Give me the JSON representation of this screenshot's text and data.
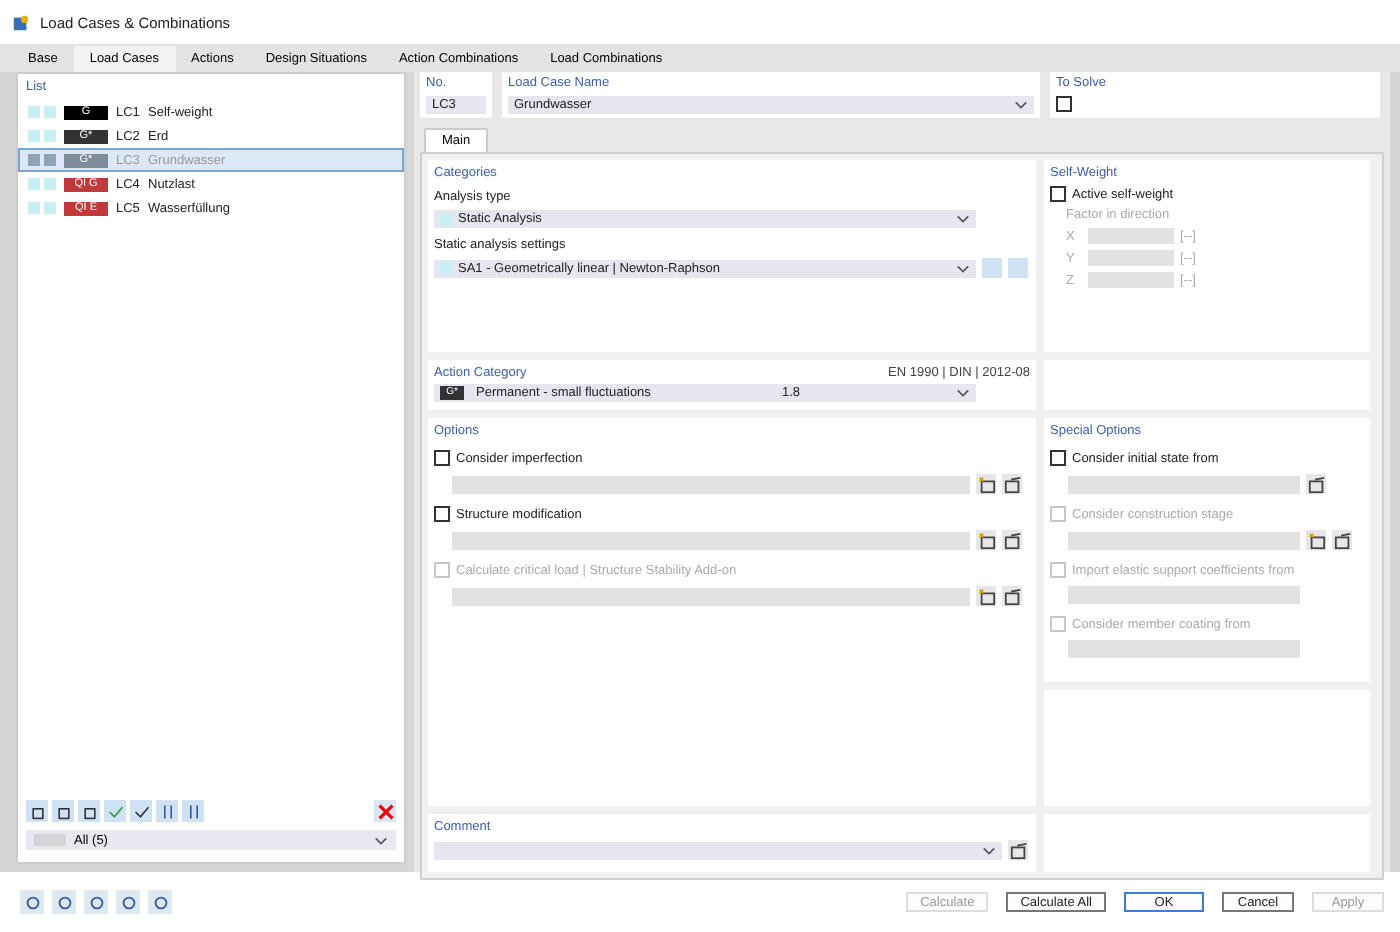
{
  "window": {
    "title": "Load Cases & Combinations"
  },
  "tabs": [
    {
      "label": "Base",
      "selected": false
    },
    {
      "label": "Load Cases",
      "selected": true
    },
    {
      "label": "Actions",
      "selected": false
    },
    {
      "label": "Design Situations",
      "selected": false
    },
    {
      "label": "Action Combinations",
      "selected": false
    },
    {
      "label": "Load Combinations",
      "selected": false
    }
  ],
  "list": {
    "label": "List",
    "filter": "All (5)",
    "items": [
      {
        "badge": "G",
        "color": "#000000",
        "number": "LC1",
        "name": "Self-weight",
        "selected": false
      },
      {
        "badge": "G*",
        "color": "#333333",
        "number": "LC2",
        "name": "Erd",
        "selected": false
      },
      {
        "badge": "G*",
        "color": "#7f8c9a",
        "number": "LC3",
        "name": "Grundwasser",
        "selected": true
      },
      {
        "badge": "QI G",
        "color": "#c0393b",
        "number": "LC4",
        "name": "Nutzlast",
        "selected": false
      },
      {
        "badge": "QI E",
        "color": "#c0393b",
        "number": "LC5",
        "name": "Wasserfüllung",
        "selected": false
      }
    ]
  },
  "header": {
    "number_label": "No.",
    "number": "LC3",
    "name_label": "Load Case Name",
    "name": "Grundwasser",
    "to_solve_label": "To Solve",
    "to_solve": false
  },
  "inner_tabs": [
    {
      "label": "Main",
      "selected": true
    }
  ],
  "categories": {
    "title": "Categories",
    "analysis_type_label": "Analysis type",
    "analysis_type": "Static Analysis",
    "settings_label": "Static analysis settings",
    "settings": "SA1 - Geometrically linear | Newton-Raphson"
  },
  "self_weight": {
    "title": "Self-Weight",
    "active_label": "Active self-weight",
    "active": false,
    "factor_label": "Factor in direction",
    "axes": [
      {
        "axis": "X",
        "unit": "[--]"
      },
      {
        "axis": "Y",
        "unit": "[--]"
      },
      {
        "axis": "Z",
        "unit": "[--]"
      }
    ]
  },
  "action_category": {
    "title": "Action Category",
    "standard": "EN 1990 | DIN | 2012-08",
    "badge": "G*",
    "color": "#333333",
    "value": "Permanent - small fluctuations",
    "code": "1.8"
  },
  "options": {
    "title": "Options",
    "items": [
      {
        "label": "Consider imperfection",
        "checked": false,
        "disabled": false
      },
      {
        "label": "Structure modification",
        "checked": false,
        "disabled": false
      },
      {
        "label": "Calculate critical load | Structure Stability Add-on",
        "checked": false,
        "disabled": true
      }
    ]
  },
  "special_options": {
    "title": "Special Options",
    "items": [
      {
        "label": "Consider initial state from",
        "checked": false,
        "disabled": false,
        "kind": "single"
      },
      {
        "label": "Consider construction stage",
        "checked": false,
        "disabled": true,
        "kind": "double"
      },
      {
        "label": "Import elastic support coefficients from",
        "checked": false,
        "disabled": true,
        "kind": "plain"
      },
      {
        "label": "Consider member coating from",
        "checked": false,
        "disabled": true,
        "kind": "plain"
      }
    ]
  },
  "comment": {
    "title": "Comment"
  },
  "buttons": [
    {
      "label": "Calculate",
      "disabled": true,
      "kind": "normal"
    },
    {
      "label": "Calculate All",
      "disabled": false,
      "kind": "normal"
    },
    {
      "label": "OK",
      "disabled": false,
      "kind": "default"
    },
    {
      "label": "Cancel",
      "disabled": false,
      "kind": "normal"
    },
    {
      "label": "Apply",
      "disabled": true,
      "kind": "normal"
    }
  ]
}
